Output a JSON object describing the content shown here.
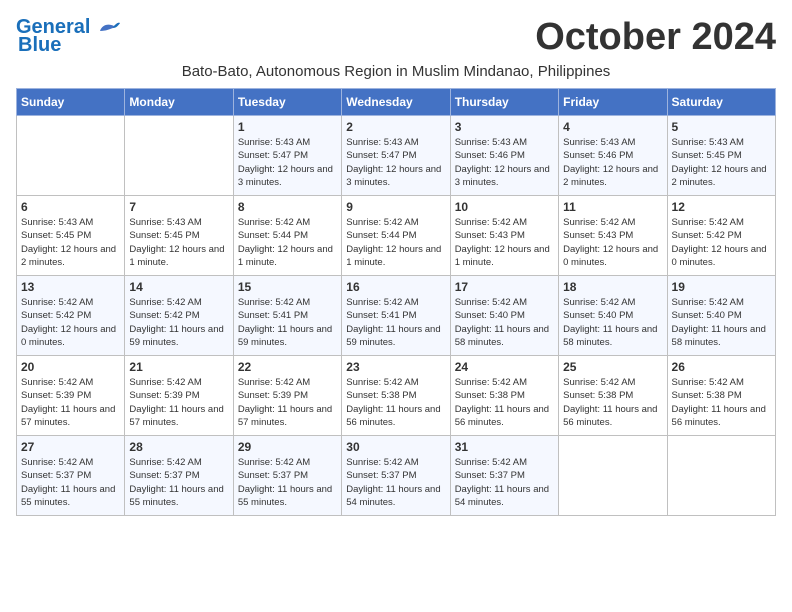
{
  "header": {
    "logo_line1": "General",
    "logo_line2": "Blue",
    "month_title": "October 2024",
    "subtitle": "Bato-Bato, Autonomous Region in Muslim Mindanao, Philippines"
  },
  "days_of_week": [
    "Sunday",
    "Monday",
    "Tuesday",
    "Wednesday",
    "Thursday",
    "Friday",
    "Saturday"
  ],
  "weeks": [
    [
      {
        "day": "",
        "sunrise": "",
        "sunset": "",
        "daylight": ""
      },
      {
        "day": "",
        "sunrise": "",
        "sunset": "",
        "daylight": ""
      },
      {
        "day": "1",
        "sunrise": "Sunrise: 5:43 AM",
        "sunset": "Sunset: 5:47 PM",
        "daylight": "Daylight: 12 hours and 3 minutes."
      },
      {
        "day": "2",
        "sunrise": "Sunrise: 5:43 AM",
        "sunset": "Sunset: 5:47 PM",
        "daylight": "Daylight: 12 hours and 3 minutes."
      },
      {
        "day": "3",
        "sunrise": "Sunrise: 5:43 AM",
        "sunset": "Sunset: 5:46 PM",
        "daylight": "Daylight: 12 hours and 3 minutes."
      },
      {
        "day": "4",
        "sunrise": "Sunrise: 5:43 AM",
        "sunset": "Sunset: 5:46 PM",
        "daylight": "Daylight: 12 hours and 2 minutes."
      },
      {
        "day": "5",
        "sunrise": "Sunrise: 5:43 AM",
        "sunset": "Sunset: 5:45 PM",
        "daylight": "Daylight: 12 hours and 2 minutes."
      }
    ],
    [
      {
        "day": "6",
        "sunrise": "Sunrise: 5:43 AM",
        "sunset": "Sunset: 5:45 PM",
        "daylight": "Daylight: 12 hours and 2 minutes."
      },
      {
        "day": "7",
        "sunrise": "Sunrise: 5:43 AM",
        "sunset": "Sunset: 5:45 PM",
        "daylight": "Daylight: 12 hours and 1 minute."
      },
      {
        "day": "8",
        "sunrise": "Sunrise: 5:42 AM",
        "sunset": "Sunset: 5:44 PM",
        "daylight": "Daylight: 12 hours and 1 minute."
      },
      {
        "day": "9",
        "sunrise": "Sunrise: 5:42 AM",
        "sunset": "Sunset: 5:44 PM",
        "daylight": "Daylight: 12 hours and 1 minute."
      },
      {
        "day": "10",
        "sunrise": "Sunrise: 5:42 AM",
        "sunset": "Sunset: 5:43 PM",
        "daylight": "Daylight: 12 hours and 1 minute."
      },
      {
        "day": "11",
        "sunrise": "Sunrise: 5:42 AM",
        "sunset": "Sunset: 5:43 PM",
        "daylight": "Daylight: 12 hours and 0 minutes."
      },
      {
        "day": "12",
        "sunrise": "Sunrise: 5:42 AM",
        "sunset": "Sunset: 5:42 PM",
        "daylight": "Daylight: 12 hours and 0 minutes."
      }
    ],
    [
      {
        "day": "13",
        "sunrise": "Sunrise: 5:42 AM",
        "sunset": "Sunset: 5:42 PM",
        "daylight": "Daylight: 12 hours and 0 minutes."
      },
      {
        "day": "14",
        "sunrise": "Sunrise: 5:42 AM",
        "sunset": "Sunset: 5:42 PM",
        "daylight": "Daylight: 11 hours and 59 minutes."
      },
      {
        "day": "15",
        "sunrise": "Sunrise: 5:42 AM",
        "sunset": "Sunset: 5:41 PM",
        "daylight": "Daylight: 11 hours and 59 minutes."
      },
      {
        "day": "16",
        "sunrise": "Sunrise: 5:42 AM",
        "sunset": "Sunset: 5:41 PM",
        "daylight": "Daylight: 11 hours and 59 minutes."
      },
      {
        "day": "17",
        "sunrise": "Sunrise: 5:42 AM",
        "sunset": "Sunset: 5:40 PM",
        "daylight": "Daylight: 11 hours and 58 minutes."
      },
      {
        "day": "18",
        "sunrise": "Sunrise: 5:42 AM",
        "sunset": "Sunset: 5:40 PM",
        "daylight": "Daylight: 11 hours and 58 minutes."
      },
      {
        "day": "19",
        "sunrise": "Sunrise: 5:42 AM",
        "sunset": "Sunset: 5:40 PM",
        "daylight": "Daylight: 11 hours and 58 minutes."
      }
    ],
    [
      {
        "day": "20",
        "sunrise": "Sunrise: 5:42 AM",
        "sunset": "Sunset: 5:39 PM",
        "daylight": "Daylight: 11 hours and 57 minutes."
      },
      {
        "day": "21",
        "sunrise": "Sunrise: 5:42 AM",
        "sunset": "Sunset: 5:39 PM",
        "daylight": "Daylight: 11 hours and 57 minutes."
      },
      {
        "day": "22",
        "sunrise": "Sunrise: 5:42 AM",
        "sunset": "Sunset: 5:39 PM",
        "daylight": "Daylight: 11 hours and 57 minutes."
      },
      {
        "day": "23",
        "sunrise": "Sunrise: 5:42 AM",
        "sunset": "Sunset: 5:38 PM",
        "daylight": "Daylight: 11 hours and 56 minutes."
      },
      {
        "day": "24",
        "sunrise": "Sunrise: 5:42 AM",
        "sunset": "Sunset: 5:38 PM",
        "daylight": "Daylight: 11 hours and 56 minutes."
      },
      {
        "day": "25",
        "sunrise": "Sunrise: 5:42 AM",
        "sunset": "Sunset: 5:38 PM",
        "daylight": "Daylight: 11 hours and 56 minutes."
      },
      {
        "day": "26",
        "sunrise": "Sunrise: 5:42 AM",
        "sunset": "Sunset: 5:38 PM",
        "daylight": "Daylight: 11 hours and 56 minutes."
      }
    ],
    [
      {
        "day": "27",
        "sunrise": "Sunrise: 5:42 AM",
        "sunset": "Sunset: 5:37 PM",
        "daylight": "Daylight: 11 hours and 55 minutes."
      },
      {
        "day": "28",
        "sunrise": "Sunrise: 5:42 AM",
        "sunset": "Sunset: 5:37 PM",
        "daylight": "Daylight: 11 hours and 55 minutes."
      },
      {
        "day": "29",
        "sunrise": "Sunrise: 5:42 AM",
        "sunset": "Sunset: 5:37 PM",
        "daylight": "Daylight: 11 hours and 55 minutes."
      },
      {
        "day": "30",
        "sunrise": "Sunrise: 5:42 AM",
        "sunset": "Sunset: 5:37 PM",
        "daylight": "Daylight: 11 hours and 54 minutes."
      },
      {
        "day": "31",
        "sunrise": "Sunrise: 5:42 AM",
        "sunset": "Sunset: 5:37 PM",
        "daylight": "Daylight: 11 hours and 54 minutes."
      },
      {
        "day": "",
        "sunrise": "",
        "sunset": "",
        "daylight": ""
      },
      {
        "day": "",
        "sunrise": "",
        "sunset": "",
        "daylight": ""
      }
    ]
  ]
}
